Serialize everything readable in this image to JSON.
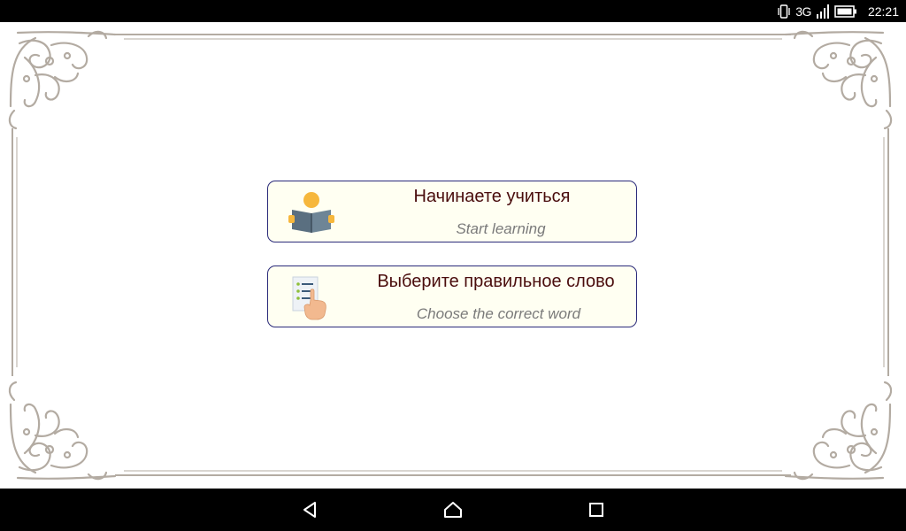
{
  "status_bar": {
    "network_label": "3G",
    "time": "22:21",
    "icons": [
      "vibrate-icon",
      "signal-icon",
      "battery-icon"
    ]
  },
  "menu": {
    "items": [
      {
        "title": "Начинаете учиться",
        "subtitle": "Start learning",
        "icon": "reading-book-icon"
      },
      {
        "title": "Выберите правильное слово",
        "subtitle": "Choose the correct word",
        "icon": "checklist-hand-icon"
      }
    ]
  },
  "nav_bar": {
    "icons": [
      "back-icon",
      "home-icon",
      "recents-icon"
    ]
  },
  "colors": {
    "card_background": "#fffff2",
    "card_border": "#2a2a7a",
    "title_text": "#4a0d0d",
    "subtitle_text": "#7a7a7a",
    "frame_ornament": "#b3aba2"
  }
}
